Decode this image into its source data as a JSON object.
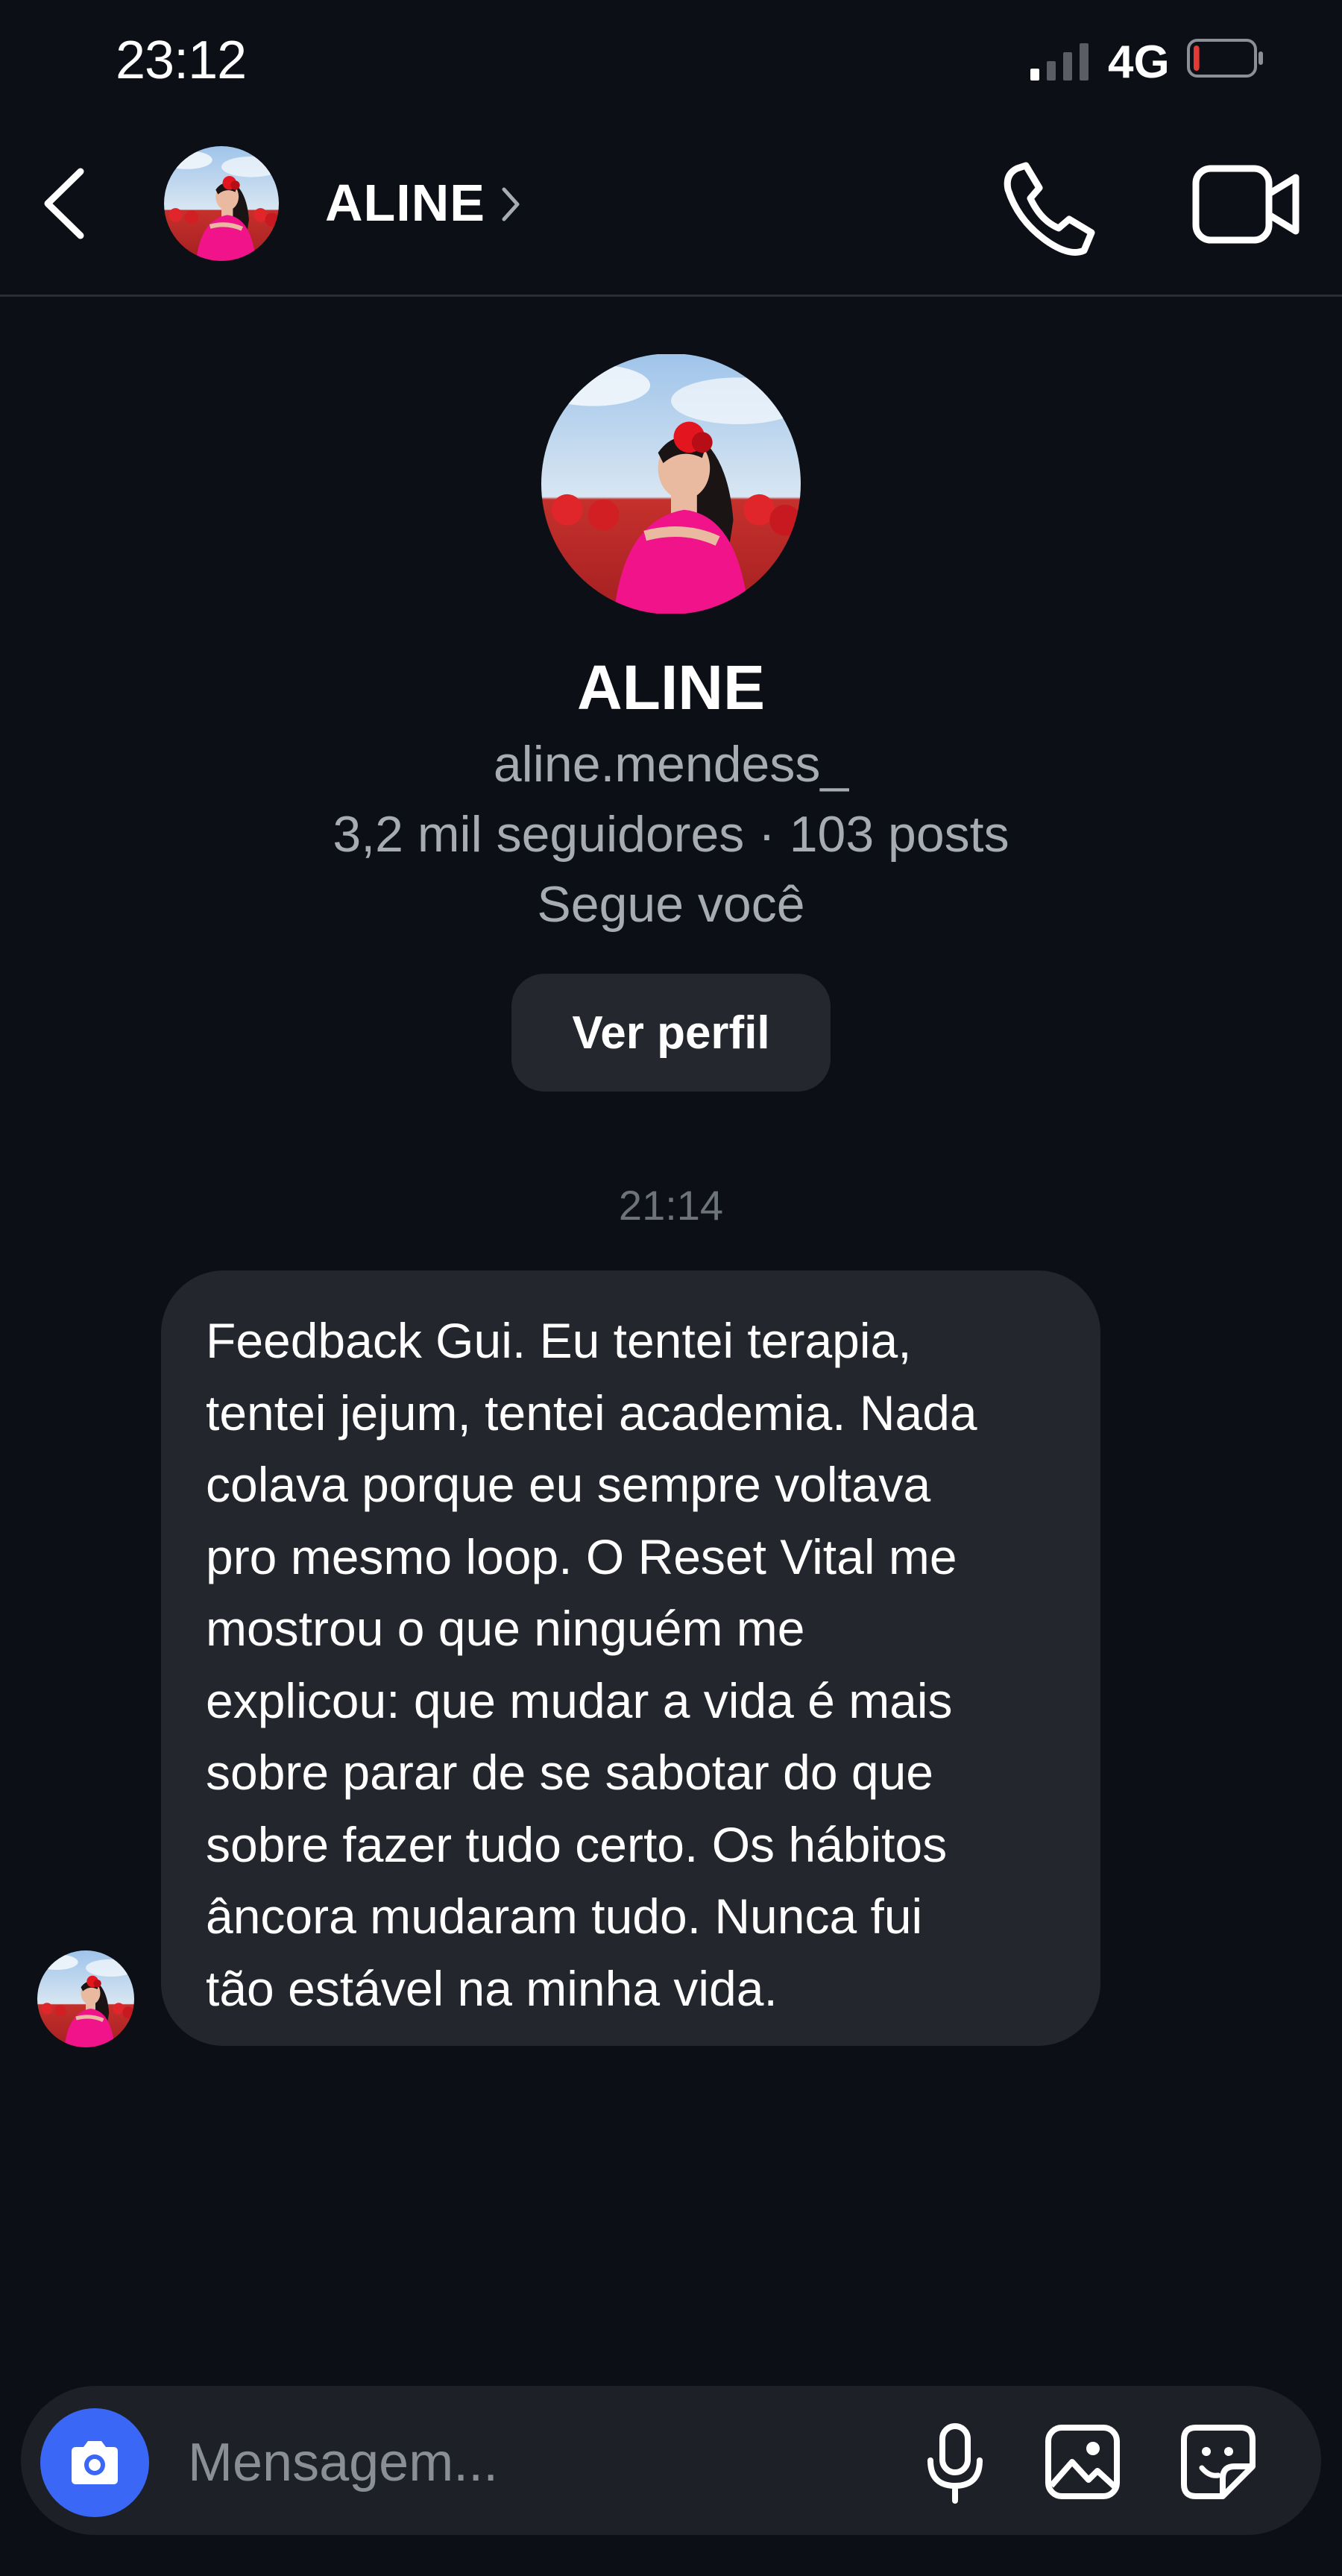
{
  "status_bar": {
    "time": "23:12",
    "network": "4G",
    "signal_bars_filled": 1,
    "signal_bars_total": 4,
    "battery_level": 0.1
  },
  "header": {
    "contact_name": "ALINE"
  },
  "profile": {
    "name": "ALINE",
    "username": "aline.mendess_",
    "stats": "3,2 mil seguidores · 103 posts",
    "follow_status": "Segue você",
    "view_profile_label": "Ver perfil"
  },
  "conversation": {
    "timestamp": "21:14",
    "messages": [
      {
        "text": "Feedback Gui. Eu tentei terapia,\ntentei jejum, tentei academia. Nada\ncolava porque eu sempre voltava\npro mesmo loop. O Reset Vital me\nmostrou o que ninguém me\nexplicou: que mudar a vida é mais\nsobre parar de se sabotar do que\nsobre fazer tudo certo. Os hábitos\nâncora mudaram tudo. Nunca fui\ntão estável na minha vida."
      }
    ]
  },
  "composer": {
    "placeholder": "Mensagem..."
  },
  "colors": {
    "background": "#0c0f16",
    "bubble": "#23262c",
    "camera_button": "#3a67f5",
    "battery_low": "#e53935"
  },
  "icons": [
    "back-arrow-icon",
    "chevron-right-icon",
    "phone-icon",
    "video-camera-icon",
    "camera-icon",
    "microphone-icon",
    "gallery-icon",
    "sticker-icon"
  ]
}
